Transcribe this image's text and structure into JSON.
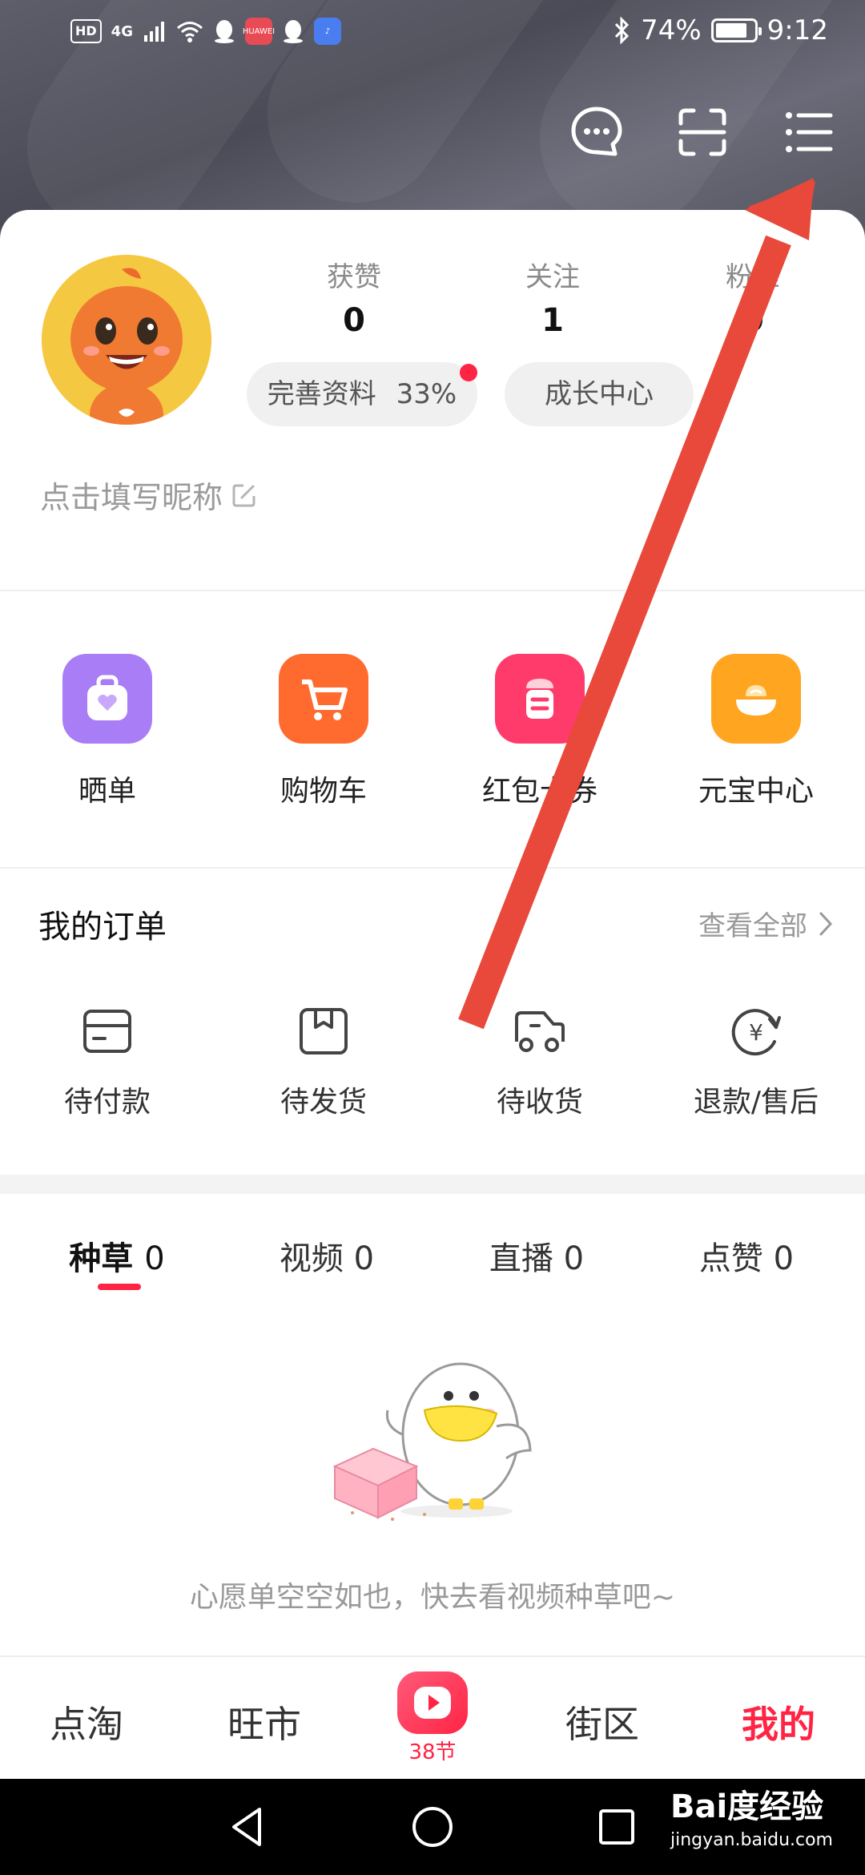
{
  "status_bar": {
    "left_chips": [
      "HD",
      "4G"
    ],
    "app_huawei": "HUAWEI",
    "battery": "74%",
    "time": "9:12"
  },
  "header_icons": [
    "message-icon",
    "scan-icon",
    "menu-icon"
  ],
  "profile": {
    "stats": [
      {
        "label": "获赞",
        "value": "0"
      },
      {
        "label": "关注",
        "value": "1"
      },
      {
        "label": "粉丝",
        "value": "0"
      }
    ],
    "complete_profile": "完善资料",
    "complete_percent": "33%",
    "growth_center": "成长中心",
    "nickname_placeholder": "点击填写昵称"
  },
  "quick_actions": [
    {
      "label": "晒单",
      "color": "#a87df5",
      "icon": "bag-heart-icon"
    },
    {
      "label": "购物车",
      "color": "#ff6a2f",
      "icon": "cart-icon"
    },
    {
      "label": "红包卡券",
      "color": "#ff3b6b",
      "icon": "red-packet-icon"
    },
    {
      "label": "元宝中心",
      "color": "#ffa51f",
      "icon": "ingot-icon"
    }
  ],
  "orders": {
    "title": "我的订单",
    "view_all": "查看全部",
    "items": [
      {
        "label": "待付款",
        "icon": "wallet-icon"
      },
      {
        "label": "待发货",
        "icon": "package-icon"
      },
      {
        "label": "待收货",
        "icon": "truck-icon"
      },
      {
        "label": "退款/售后",
        "icon": "refund-icon"
      }
    ]
  },
  "content_tabs": [
    {
      "label": "种草",
      "count": "0"
    },
    {
      "label": "视频",
      "count": "0"
    },
    {
      "label": "直播",
      "count": "0"
    },
    {
      "label": "点赞",
      "count": "0"
    }
  ],
  "empty_state": "心愿单空空如也，快去看视频种草吧~",
  "bottom_nav": {
    "items": [
      "点淘",
      "旺市",
      "街区",
      "我的"
    ],
    "center_sub": "38节",
    "active": "我的",
    "accent": "#ff2444"
  },
  "watermark": {
    "brand": "Bai度经验",
    "url": "jingyan.baidu.com"
  }
}
